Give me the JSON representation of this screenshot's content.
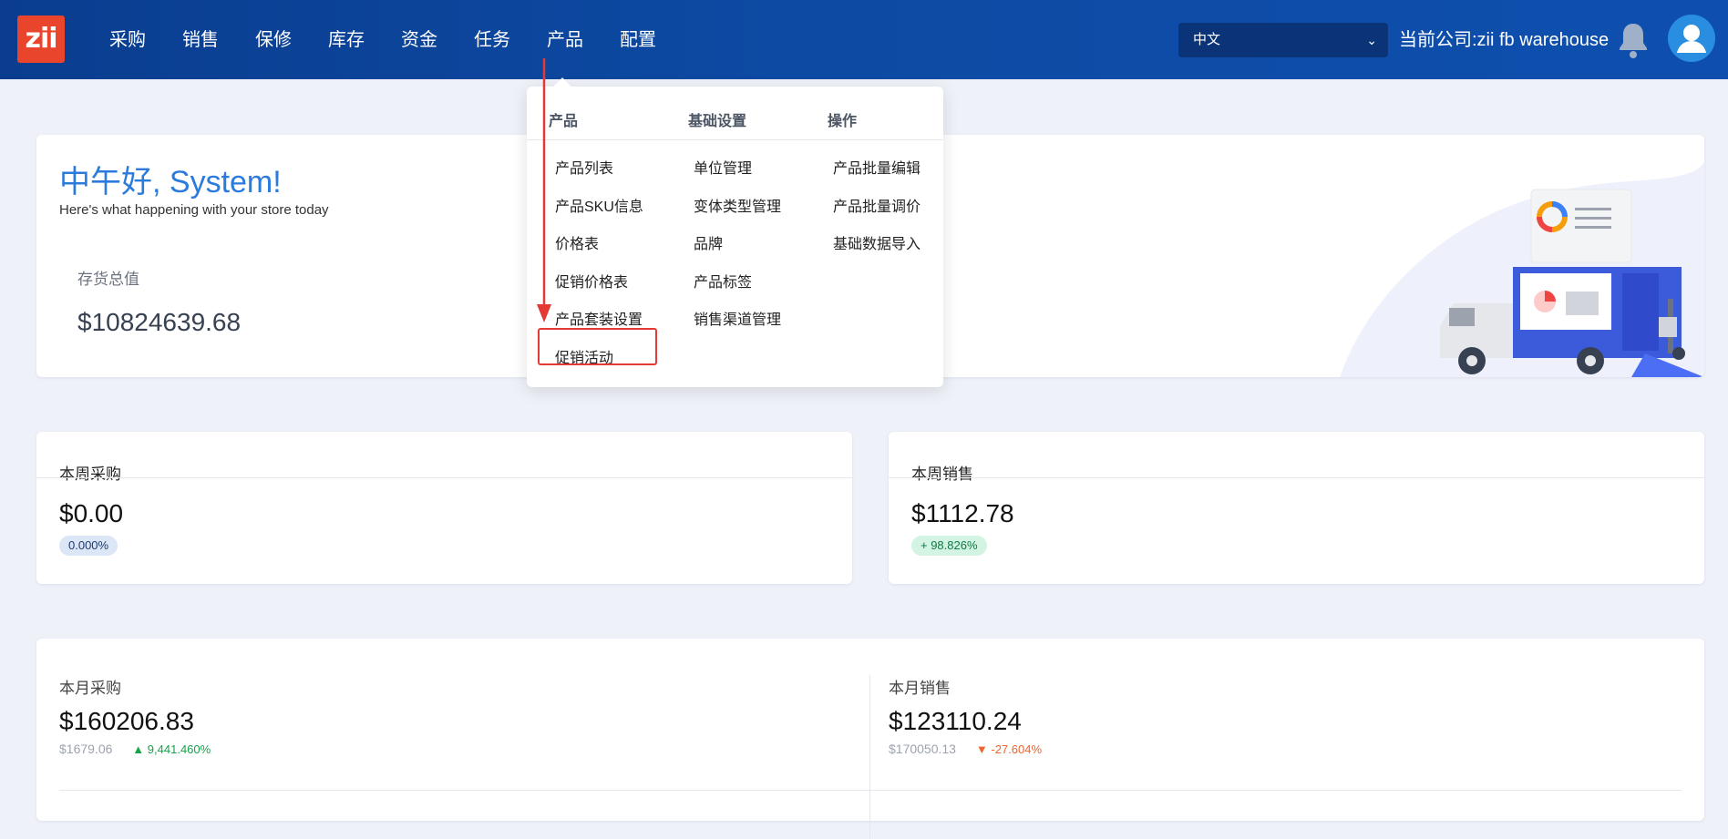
{
  "header": {
    "logo_text": "zii",
    "nav": [
      "采购",
      "销售",
      "保修",
      "库存",
      "资金",
      "任务",
      "产品",
      "配置"
    ],
    "language": "中文",
    "company": "当前公司:zii fb warehouse"
  },
  "greeting": {
    "title": "中午好, System!",
    "subtitle": "Here's what happening with your store today",
    "inventory_label": "存货总值",
    "inventory_value": "$10824639.68"
  },
  "dropdown": {
    "columns": [
      {
        "heading": "产品",
        "items": [
          "产品列表",
          "产品SKU信息",
          "价格表",
          "促销价格表",
          "产品套装设置",
          "促销活动"
        ]
      },
      {
        "heading": "基础设置",
        "items": [
          "单位管理",
          "变体类型管理",
          "品牌",
          "产品标签",
          "销售渠道管理"
        ]
      },
      {
        "heading": "操作",
        "items": [
          "产品批量编辑",
          "产品批量调价",
          "基础数据导入"
        ]
      }
    ]
  },
  "week": {
    "purchase": {
      "label": "本周采购",
      "value": "$0.00",
      "badge": "0.000%"
    },
    "sales": {
      "label": "本周销售",
      "value": "$1112.78",
      "badge": "+ 98.826%"
    }
  },
  "month": {
    "purchase": {
      "label": "本月采购",
      "value": "$160206.83",
      "previous": "$1679.06",
      "pct": "9,441.460%"
    },
    "sales": {
      "label": "本月销售",
      "value": "$123110.24",
      "previous": "$170050.13",
      "pct": "-27.604%"
    }
  },
  "colors": {
    "header": "#0d4aa3",
    "accent_blue": "#2b7bdc",
    "logo": "#e8452c",
    "highlight": "#e53935",
    "up": "#16a34a",
    "down": "#f0642d"
  }
}
